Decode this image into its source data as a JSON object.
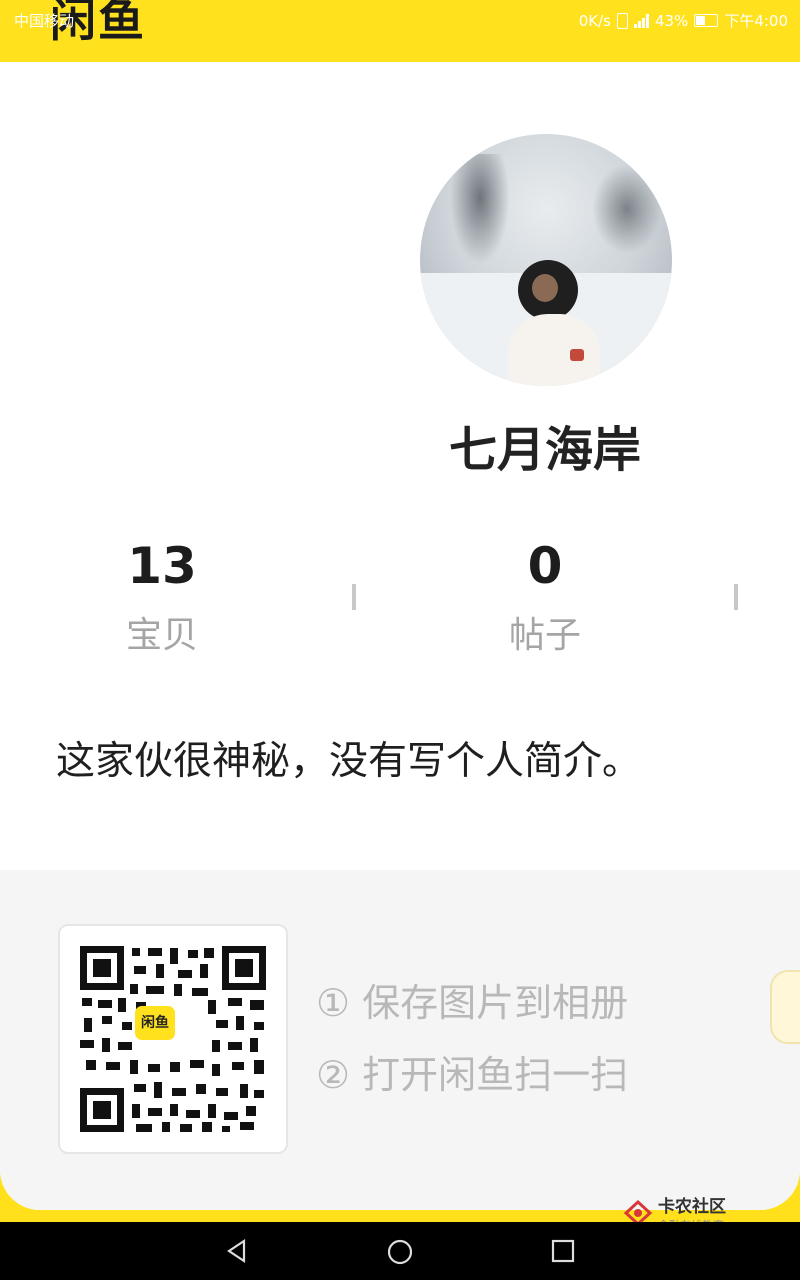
{
  "status": {
    "carrier": "中国移动",
    "speed": "0K/s",
    "battery": "43%",
    "time": "下午4:00"
  },
  "app": {
    "logo": "闲鱼"
  },
  "profile": {
    "nickname": "七月海岸",
    "stats": [
      {
        "value": "13",
        "label": "宝贝"
      },
      {
        "value": "0",
        "label": "帖子"
      }
    ],
    "bio": "这家伙很神秘，没有写个人简介。"
  },
  "qr": {
    "logo_text": "闲鱼",
    "steps": [
      "① 保存图片到相册",
      "② 打开闲鱼扫一扫"
    ]
  },
  "watermark": {
    "title": "卡农社区",
    "subtitle": "金融在线教育"
  },
  "colors": {
    "brand_yellow": "#ffe21d",
    "text_dark": "#1f1f1f",
    "text_gray": "#a5a5a5"
  }
}
